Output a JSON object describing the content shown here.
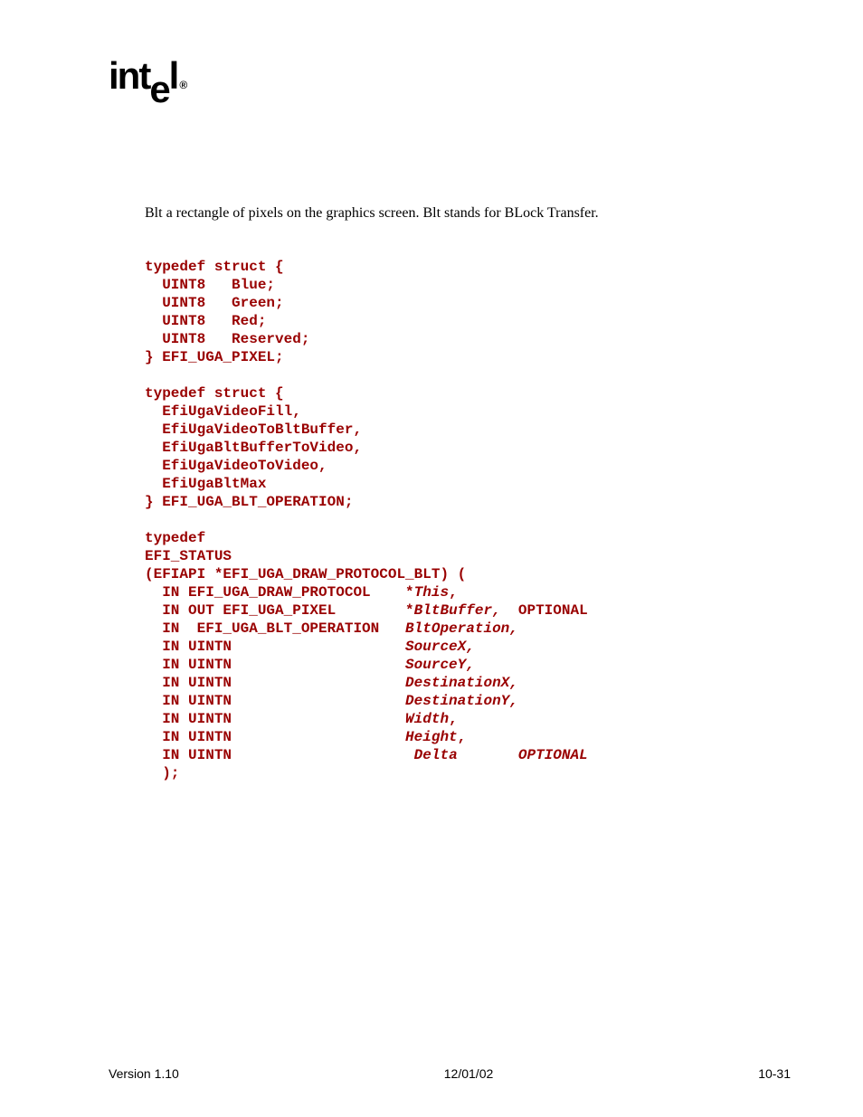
{
  "logo": "intel",
  "summary": "Blt a rectangle of pixels on the graphics screen.  Blt stands for BLock Transfer.",
  "code": {
    "s1_open": "typedef struct {",
    "s1_l1a": "  UINT8   Blue;",
    "s1_l2a": "  UINT8   Green;",
    "s1_l3a": "  UINT8   Red;",
    "s1_l4a": "  UINT8   Reserved;",
    "s1_close": "} EFI_UGA_PIXEL;",
    "blank1": "",
    "s2_open": "typedef struct {",
    "s2_l1": "  EfiUgaVideoFill,",
    "s2_l2": "  EfiUgaVideoToBltBuffer,",
    "s2_l3": "  EfiUgaBltBufferToVideo,",
    "s2_l4": "  EfiUgaVideoToVideo,",
    "s2_l5": "  EfiUgaBltMax",
    "s2_close": "} EFI_UGA_BLT_OPERATION;",
    "blank2": "",
    "t1": "typedef",
    "t2": "EFI_STATUS",
    "t3": "(EFIAPI *EFI_UGA_DRAW_PROTOCOL_BLT) (",
    "p1a": "  IN EFI_UGA_DRAW_PROTOCOL    *",
    "p1b": "This",
    "p1c": ",",
    "p2a": "  IN OUT EFI_UGA_PIXEL        *",
    "p2b": "BltBuffer,",
    "p2c": "  OPTIONAL",
    "p3a": "  IN  EFI_UGA_BLT_OPERATION   ",
    "p3b": "BltOperation,",
    "p4a": "  IN UINTN                    ",
    "p4b": "SourceX,",
    "p5a": "  IN UINTN                    ",
    "p5b": "SourceY,",
    "p6a": "  IN UINTN                    ",
    "p6b": "DestinationX,",
    "p7a": "  IN UINTN                    ",
    "p7b": "DestinationY,",
    "p8a": "  IN UINTN                    ",
    "p8b": "Width",
    "p8c": ",",
    "p9a": "  IN UINTN                    ",
    "p9b": "Height",
    "p9c": ",",
    "p10a": "  IN UINTN                     ",
    "p10b": "Delta       OPTIONAL",
    "pend": "  );"
  },
  "footer": {
    "left": "Version 1.10",
    "center": "12/01/02",
    "right": "10-31"
  }
}
